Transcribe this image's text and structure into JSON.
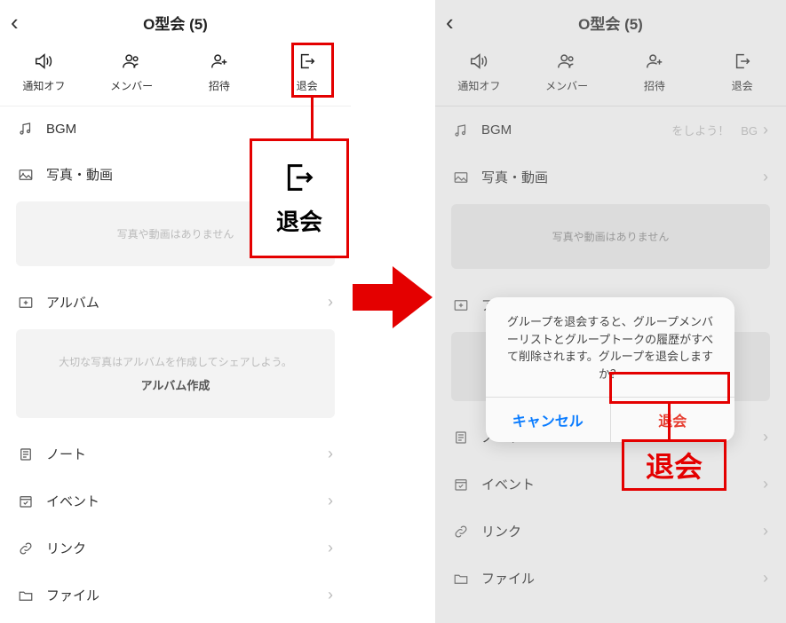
{
  "left": {
    "title": "O型会 (5)",
    "actions": {
      "notify": "通知オフ",
      "members": "メンバー",
      "invite": "招待",
      "leave": "退会"
    },
    "rows": {
      "bgm": "BGM",
      "photos": "写真・動画",
      "album": "アルバム",
      "note": "ノート",
      "event": "イベント",
      "link": "リンク",
      "file": "ファイル"
    },
    "photos_empty": "写真や動画はありません",
    "album_empty_1": "大切な写真はアルバムを作成してシェアしよう。",
    "album_empty_2": "アルバム作成"
  },
  "right": {
    "title": "O型会 (5)",
    "bgm_extra": "をしよう！　BG",
    "photos_empty": "写真や動画はありません",
    "album_short": "ア",
    "modal_text": "グループを退会すると、グループメンバーリストとグループトークの履歴がすべて削除されます。グループを退会しますか？",
    "modal_cancel": "キャンセル",
    "modal_confirm": "退会"
  },
  "annotations": {
    "zoom_leave": "退会",
    "big_leave": "退会"
  }
}
